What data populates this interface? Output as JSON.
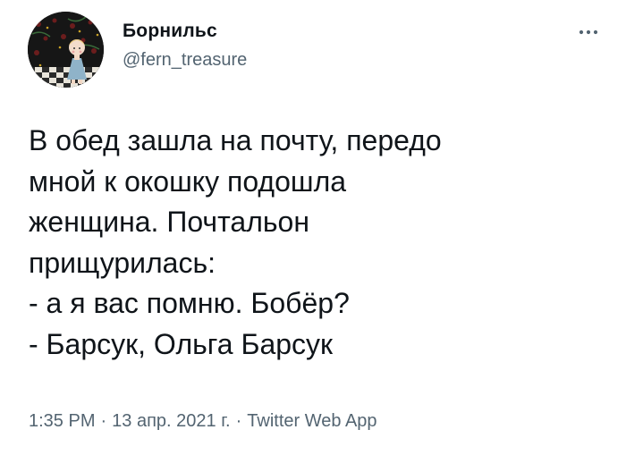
{
  "tweet": {
    "author": {
      "display_name": "Борнильс",
      "handle": "@fern_treasure",
      "avatar_icon": "profile-picture"
    },
    "more_icon": "more-dots-icon",
    "text": "В обед зашла на почту, передо\nмной к окошку подошла\nженщина. Почтальон\nприщурилась:\n- а я вас помню. Бобёр?\n- Барсук, Ольга Барсук",
    "meta": {
      "time": "1:35 PM",
      "separator": "·",
      "date": "13 апр. 2021 г.",
      "source": "Twitter Web App"
    },
    "colors": {
      "text": "#0f1419",
      "secondary": "#536471"
    }
  }
}
